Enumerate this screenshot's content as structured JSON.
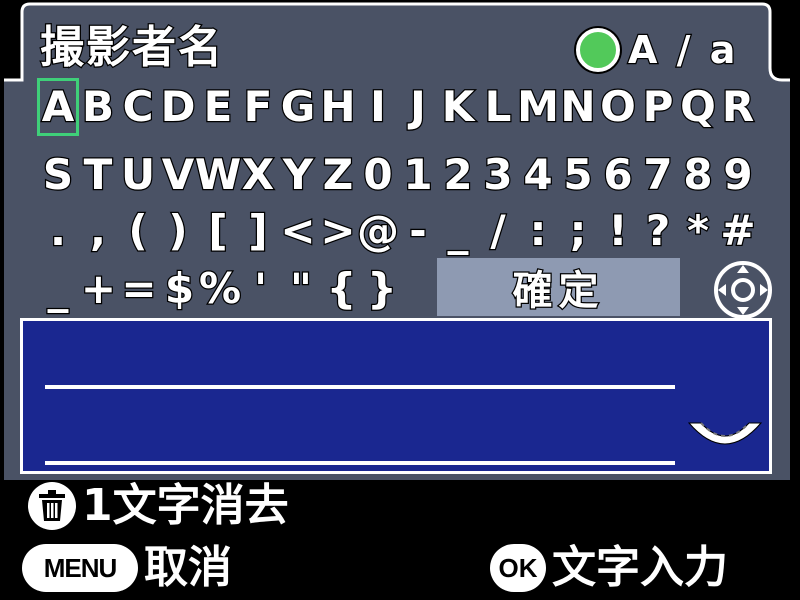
{
  "title": "撮影者名",
  "case_toggle": {
    "label": "A / a",
    "indicator_color": "#52c95a"
  },
  "character_rows": [
    [
      "A",
      "B",
      "C",
      "D",
      "E",
      "F",
      "G",
      "H",
      "I",
      "J",
      "K",
      "L",
      "M",
      "N",
      "O",
      "P",
      "Q",
      "R"
    ],
    [
      "S",
      "T",
      "U",
      "V",
      "W",
      "X",
      "Y",
      "Z",
      "0",
      "1",
      "2",
      "3",
      "4",
      "5",
      "6",
      "7",
      "8",
      "9"
    ],
    [
      ".",
      ",",
      "(",
      ")",
      "[",
      "]",
      "<",
      ">",
      "@",
      "-",
      "_",
      "/",
      ":",
      ";",
      "!",
      "?",
      "*",
      "#"
    ],
    [
      "_",
      "+",
      "=",
      "$",
      "%",
      "'",
      "\"",
      "{",
      "}"
    ]
  ],
  "selected_char": "A",
  "confirm_button": {
    "label": "確定"
  },
  "hints": {
    "delete": {
      "icon": "trash-icon",
      "label": "1文字消去"
    },
    "cancel": {
      "button": "MENU",
      "label": "取消"
    },
    "enter": {
      "button": "OK",
      "label": "文字入力"
    }
  },
  "colors": {
    "panel": "#4a5265",
    "text_box": "#1a2790",
    "confirm": "#8e9ab2",
    "selection": "#3fcf79"
  }
}
